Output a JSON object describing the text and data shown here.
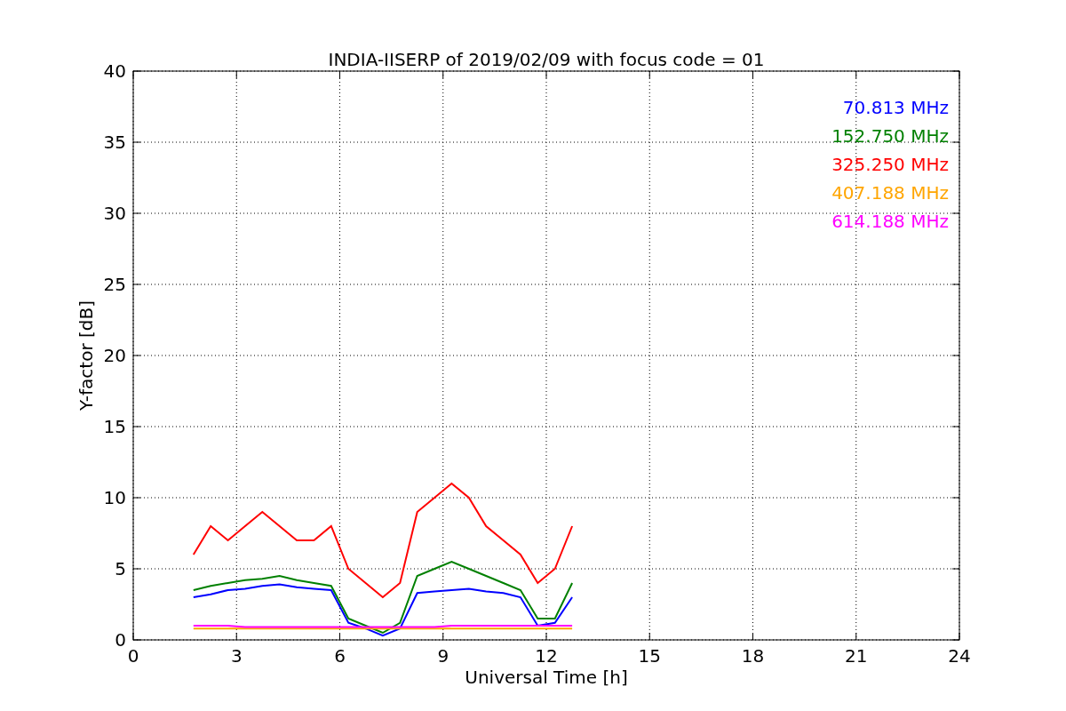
{
  "figure": {
    "chart_data": {
      "type": "line",
      "title": "INDIA-IISERP of 2019/02/09 with focus code = 01",
      "xlabel": "Universal Time [h]",
      "ylabel": "Y-factor [dB]",
      "grid": true,
      "xlim": [
        0,
        24
      ],
      "ylim": [
        0,
        40
      ],
      "xticks": [
        0,
        3,
        6,
        9,
        12,
        15,
        18,
        21,
        24
      ],
      "yticks": [
        0,
        5,
        10,
        15,
        20,
        25,
        30,
        35,
        40
      ],
      "x": [
        1.75,
        2.25,
        2.75,
        3.25,
        3.75,
        4.25,
        4.75,
        5.25,
        5.75,
        6.25,
        6.75,
        7.25,
        7.75,
        8.25,
        8.75,
        9.25,
        9.75,
        10.25,
        10.75,
        11.25,
        11.75,
        12.25,
        12.75
      ],
      "series": [
        {
          "name": "70.813 MHz",
          "color": "#0000ff",
          "values": [
            3,
            3.2,
            3.5,
            3.6,
            3.8,
            3.9,
            3.7,
            3.6,
            3.5,
            1.2,
            0.8,
            0.3,
            0.8,
            3.3,
            3.4,
            3.5,
            3.6,
            3.4,
            3.3,
            3.0,
            1.0,
            1.2,
            3.0
          ]
        },
        {
          "name": "152.750 MHz",
          "color": "#008000",
          "values": [
            3.5,
            3.8,
            4,
            4.2,
            4.3,
            4.5,
            4.2,
            4,
            3.8,
            1.5,
            1,
            0.5,
            1.2,
            4.5,
            5,
            5.5,
            5,
            4.5,
            4,
            3.5,
            1.5,
            1.5,
            4
          ]
        },
        {
          "name": "325.250 MHz",
          "color": "#ff0000",
          "values": [
            6,
            8,
            7,
            8,
            9,
            8,
            7,
            7,
            8,
            5,
            4,
            3,
            4,
            9,
            10,
            11,
            10,
            8,
            7,
            6,
            4,
            5,
            8
          ]
        },
        {
          "name": "407.188 MHz",
          "color": "#ffa500",
          "values": [
            0.8,
            0.8,
            0.8,
            0.8,
            0.8,
            0.8,
            0.8,
            0.8,
            0.8,
            0.8,
            0.8,
            0.8,
            0.8,
            0.8,
            0.8,
            0.8,
            0.8,
            0.8,
            0.8,
            0.8,
            0.8,
            0.8,
            0.8
          ]
        },
        {
          "name": "614.188 MHz",
          "color": "#ff00ff",
          "values": [
            1,
            1,
            1,
            0.9,
            0.9,
            0.9,
            0.9,
            0.9,
            0.9,
            0.9,
            0.9,
            0.9,
            0.9,
            0.9,
            0.9,
            1,
            1,
            1,
            1,
            1,
            1,
            1,
            1
          ]
        }
      ]
    }
  }
}
